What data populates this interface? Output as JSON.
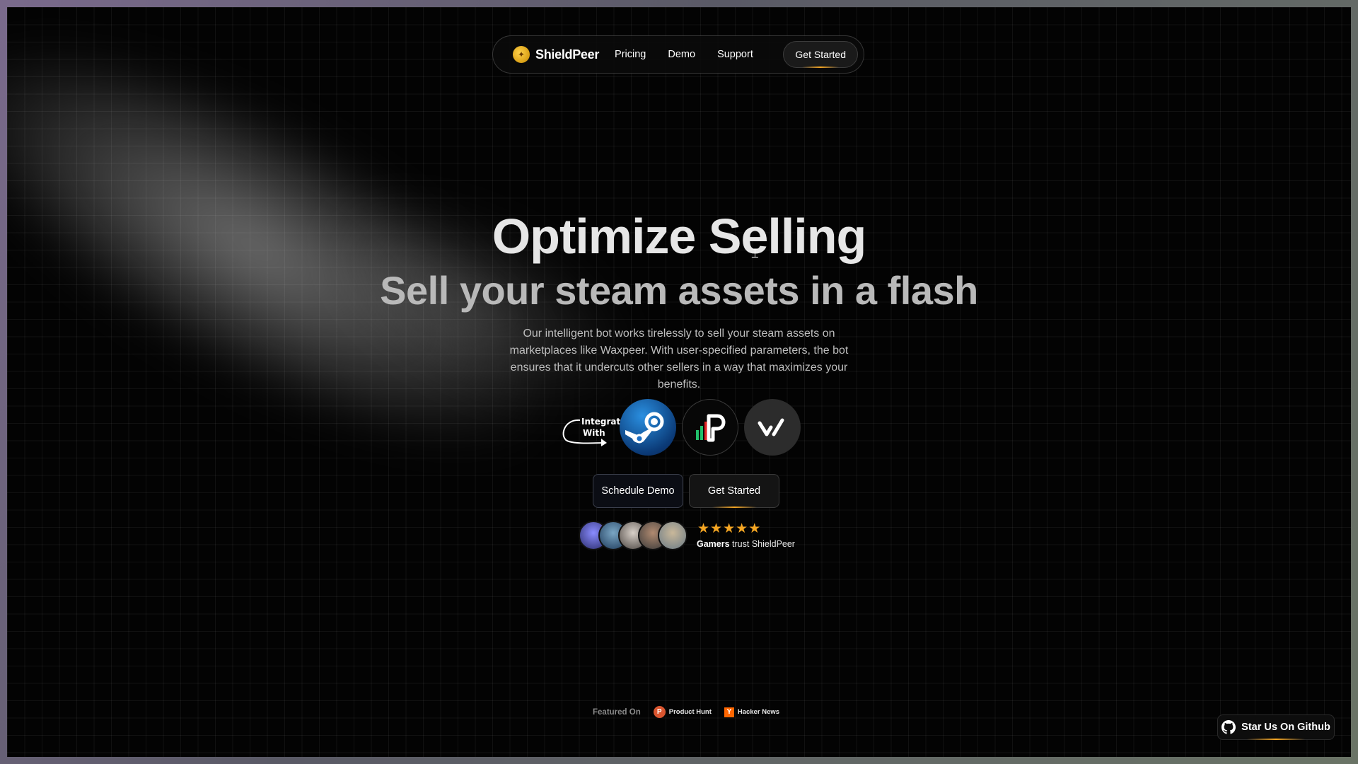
{
  "nav": {
    "brand": "ShieldPeer",
    "links": [
      "Pricing",
      "Demo",
      "Support"
    ],
    "cta": "Get Started"
  },
  "hero": {
    "title": "Optimize Selling",
    "subtitle": "Sell your steam assets in a flash",
    "description": "Our intelligent bot works tirelessly to sell your steam assets on marketplaces like Waxpeer. With user-specified parameters, the bot ensures that it undercuts other sellers in a way that maximizes your benefits."
  },
  "integrations": {
    "label_line1": "Integrate",
    "label_line2": "With",
    "logos": [
      "steam-logo",
      "pricempire-logo",
      "waxpeer-logo"
    ]
  },
  "actions": {
    "schedule_demo": "Schedule Demo",
    "get_started": "Get Started"
  },
  "social_proof": {
    "rating_stars": 5,
    "trust_bold": "Gamers",
    "trust_rest": " trust ShieldPeer"
  },
  "featured": {
    "label": "Featured On",
    "items": [
      "Product Hunt",
      "Hacker News"
    ]
  },
  "github": {
    "label": "Star Us On Github"
  },
  "colors": {
    "accent": "#f5a623",
    "background": "#030303"
  }
}
